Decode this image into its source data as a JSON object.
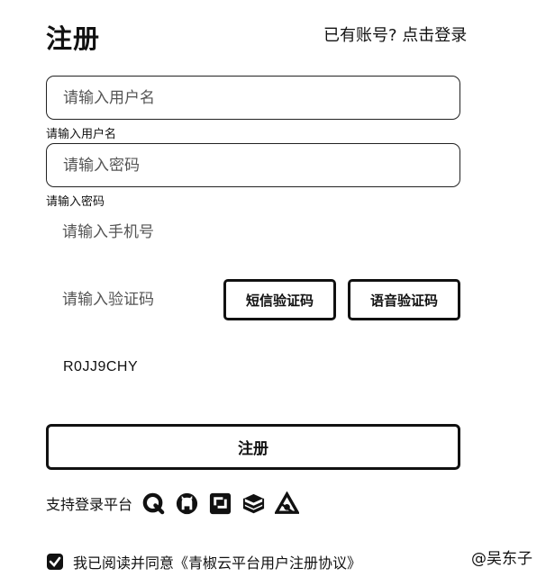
{
  "header": {
    "title": "注册",
    "login_prompt": "已有账号? 点击登录"
  },
  "form": {
    "username": {
      "placeholder": "请输入用户名",
      "value": "",
      "hint": "请输入用户名"
    },
    "password": {
      "placeholder": "请输入密码",
      "value": "",
      "hint": "请输入密码"
    },
    "phone": {
      "placeholder": "请输入手机号",
      "value": ""
    },
    "code": {
      "placeholder": "请输入验证码",
      "value": ""
    },
    "sms_code_button": "短信验证码",
    "voice_code_button": "语音验证码",
    "captcha_text": "R0JJ9CHY",
    "submit_label": "注册"
  },
  "platforms": {
    "label": "支持登录平台",
    "icons": [
      "qq-style-q-icon",
      "github-icon",
      "gitee-square-icon",
      "stack-layers-icon",
      "triangle-logo-icon"
    ]
  },
  "agreement": {
    "checked": true,
    "text": "我已阅读并同意",
    "link": "《青椒云平台用户注册协议》"
  },
  "watermark": "@吴东子",
  "colors": {
    "primary": "#111111",
    "background": "#ffffff"
  }
}
